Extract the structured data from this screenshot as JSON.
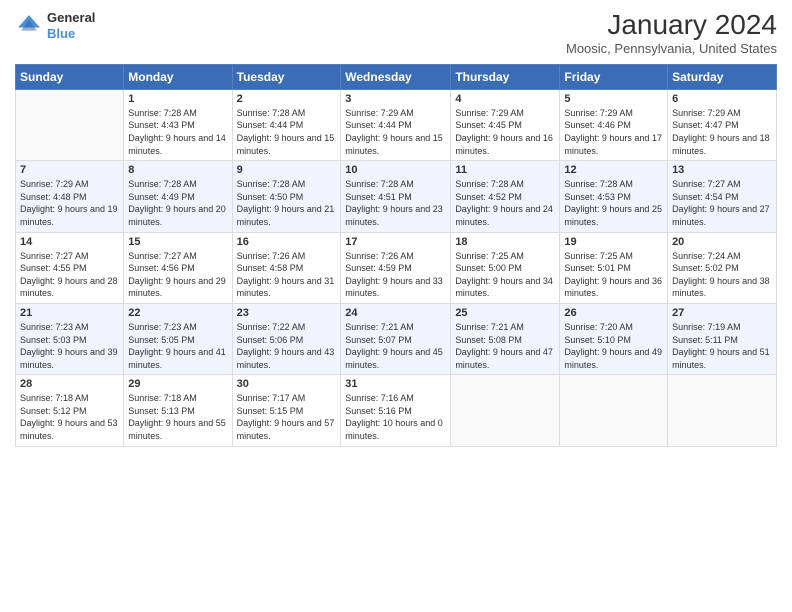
{
  "header": {
    "logo_general": "General",
    "logo_blue": "Blue",
    "title": "January 2024",
    "subtitle": "Moosic, Pennsylvania, United States"
  },
  "days_of_week": [
    "Sunday",
    "Monday",
    "Tuesday",
    "Wednesday",
    "Thursday",
    "Friday",
    "Saturday"
  ],
  "weeks": [
    [
      {
        "day": "",
        "sunrise": "",
        "sunset": "",
        "daylight": ""
      },
      {
        "day": "1",
        "sunrise": "Sunrise: 7:28 AM",
        "sunset": "Sunset: 4:43 PM",
        "daylight": "Daylight: 9 hours and 14 minutes."
      },
      {
        "day": "2",
        "sunrise": "Sunrise: 7:28 AM",
        "sunset": "Sunset: 4:44 PM",
        "daylight": "Daylight: 9 hours and 15 minutes."
      },
      {
        "day": "3",
        "sunrise": "Sunrise: 7:29 AM",
        "sunset": "Sunset: 4:44 PM",
        "daylight": "Daylight: 9 hours and 15 minutes."
      },
      {
        "day": "4",
        "sunrise": "Sunrise: 7:29 AM",
        "sunset": "Sunset: 4:45 PM",
        "daylight": "Daylight: 9 hours and 16 minutes."
      },
      {
        "day": "5",
        "sunrise": "Sunrise: 7:29 AM",
        "sunset": "Sunset: 4:46 PM",
        "daylight": "Daylight: 9 hours and 17 minutes."
      },
      {
        "day": "6",
        "sunrise": "Sunrise: 7:29 AM",
        "sunset": "Sunset: 4:47 PM",
        "daylight": "Daylight: 9 hours and 18 minutes."
      }
    ],
    [
      {
        "day": "7",
        "sunrise": "Sunrise: 7:29 AM",
        "sunset": "Sunset: 4:48 PM",
        "daylight": "Daylight: 9 hours and 19 minutes."
      },
      {
        "day": "8",
        "sunrise": "Sunrise: 7:28 AM",
        "sunset": "Sunset: 4:49 PM",
        "daylight": "Daylight: 9 hours and 20 minutes."
      },
      {
        "day": "9",
        "sunrise": "Sunrise: 7:28 AM",
        "sunset": "Sunset: 4:50 PM",
        "daylight": "Daylight: 9 hours and 21 minutes."
      },
      {
        "day": "10",
        "sunrise": "Sunrise: 7:28 AM",
        "sunset": "Sunset: 4:51 PM",
        "daylight": "Daylight: 9 hours and 23 minutes."
      },
      {
        "day": "11",
        "sunrise": "Sunrise: 7:28 AM",
        "sunset": "Sunset: 4:52 PM",
        "daylight": "Daylight: 9 hours and 24 minutes."
      },
      {
        "day": "12",
        "sunrise": "Sunrise: 7:28 AM",
        "sunset": "Sunset: 4:53 PM",
        "daylight": "Daylight: 9 hours and 25 minutes."
      },
      {
        "day": "13",
        "sunrise": "Sunrise: 7:27 AM",
        "sunset": "Sunset: 4:54 PM",
        "daylight": "Daylight: 9 hours and 27 minutes."
      }
    ],
    [
      {
        "day": "14",
        "sunrise": "Sunrise: 7:27 AM",
        "sunset": "Sunset: 4:55 PM",
        "daylight": "Daylight: 9 hours and 28 minutes."
      },
      {
        "day": "15",
        "sunrise": "Sunrise: 7:27 AM",
        "sunset": "Sunset: 4:56 PM",
        "daylight": "Daylight: 9 hours and 29 minutes."
      },
      {
        "day": "16",
        "sunrise": "Sunrise: 7:26 AM",
        "sunset": "Sunset: 4:58 PM",
        "daylight": "Daylight: 9 hours and 31 minutes."
      },
      {
        "day": "17",
        "sunrise": "Sunrise: 7:26 AM",
        "sunset": "Sunset: 4:59 PM",
        "daylight": "Daylight: 9 hours and 33 minutes."
      },
      {
        "day": "18",
        "sunrise": "Sunrise: 7:25 AM",
        "sunset": "Sunset: 5:00 PM",
        "daylight": "Daylight: 9 hours and 34 minutes."
      },
      {
        "day": "19",
        "sunrise": "Sunrise: 7:25 AM",
        "sunset": "Sunset: 5:01 PM",
        "daylight": "Daylight: 9 hours and 36 minutes."
      },
      {
        "day": "20",
        "sunrise": "Sunrise: 7:24 AM",
        "sunset": "Sunset: 5:02 PM",
        "daylight": "Daylight: 9 hours and 38 minutes."
      }
    ],
    [
      {
        "day": "21",
        "sunrise": "Sunrise: 7:23 AM",
        "sunset": "Sunset: 5:03 PM",
        "daylight": "Daylight: 9 hours and 39 minutes."
      },
      {
        "day": "22",
        "sunrise": "Sunrise: 7:23 AM",
        "sunset": "Sunset: 5:05 PM",
        "daylight": "Daylight: 9 hours and 41 minutes."
      },
      {
        "day": "23",
        "sunrise": "Sunrise: 7:22 AM",
        "sunset": "Sunset: 5:06 PM",
        "daylight": "Daylight: 9 hours and 43 minutes."
      },
      {
        "day": "24",
        "sunrise": "Sunrise: 7:21 AM",
        "sunset": "Sunset: 5:07 PM",
        "daylight": "Daylight: 9 hours and 45 minutes."
      },
      {
        "day": "25",
        "sunrise": "Sunrise: 7:21 AM",
        "sunset": "Sunset: 5:08 PM",
        "daylight": "Daylight: 9 hours and 47 minutes."
      },
      {
        "day": "26",
        "sunrise": "Sunrise: 7:20 AM",
        "sunset": "Sunset: 5:10 PM",
        "daylight": "Daylight: 9 hours and 49 minutes."
      },
      {
        "day": "27",
        "sunrise": "Sunrise: 7:19 AM",
        "sunset": "Sunset: 5:11 PM",
        "daylight": "Daylight: 9 hours and 51 minutes."
      }
    ],
    [
      {
        "day": "28",
        "sunrise": "Sunrise: 7:18 AM",
        "sunset": "Sunset: 5:12 PM",
        "daylight": "Daylight: 9 hours and 53 minutes."
      },
      {
        "day": "29",
        "sunrise": "Sunrise: 7:18 AM",
        "sunset": "Sunset: 5:13 PM",
        "daylight": "Daylight: 9 hours and 55 minutes."
      },
      {
        "day": "30",
        "sunrise": "Sunrise: 7:17 AM",
        "sunset": "Sunset: 5:15 PM",
        "daylight": "Daylight: 9 hours and 57 minutes."
      },
      {
        "day": "31",
        "sunrise": "Sunrise: 7:16 AM",
        "sunset": "Sunset: 5:16 PM",
        "daylight": "Daylight: 10 hours and 0 minutes."
      },
      {
        "day": "",
        "sunrise": "",
        "sunset": "",
        "daylight": ""
      },
      {
        "day": "",
        "sunrise": "",
        "sunset": "",
        "daylight": ""
      },
      {
        "day": "",
        "sunrise": "",
        "sunset": "",
        "daylight": ""
      }
    ]
  ]
}
